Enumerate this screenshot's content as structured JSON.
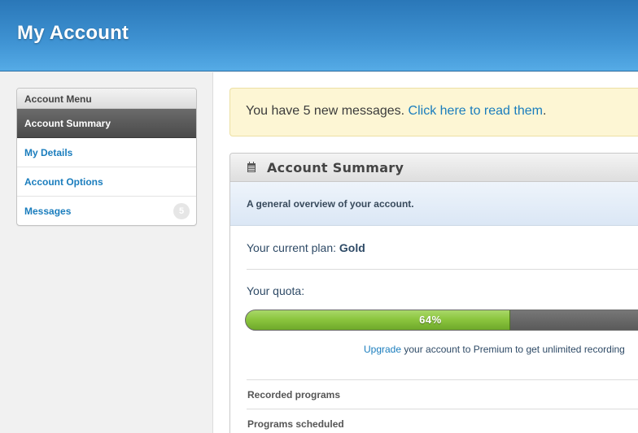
{
  "header": {
    "title": "My Account"
  },
  "sidebar": {
    "menu_title": "Account Menu",
    "items": [
      {
        "label": "Account Summary",
        "active": true
      },
      {
        "label": "My Details",
        "active": false
      },
      {
        "label": "Account Options",
        "active": false
      },
      {
        "label": "Messages",
        "active": false,
        "badge": "5"
      }
    ]
  },
  "notice": {
    "text": "You have 5 new messages.",
    "link": "Click here to read them",
    "suffix": "."
  },
  "panel": {
    "icon": "calendar-icon",
    "title": "Account Summary",
    "description": "A general overview of your account.",
    "plan_label": "Your current plan:",
    "plan_value": "Gold",
    "quota_label": "Your quota:",
    "quota_percent": 64,
    "quota_text": "64%",
    "upgrade_link": "Upgrade",
    "upgrade_text": "your account to Premium to get unlimited recording",
    "stats": [
      {
        "label": "Recorded programs"
      },
      {
        "label": "Programs scheduled"
      }
    ]
  },
  "colors": {
    "header_blue": "#3f93d3",
    "link_blue": "#1a7dbd",
    "progress_green": "#8cc63f",
    "notice_bg": "#fdf6d4"
  }
}
